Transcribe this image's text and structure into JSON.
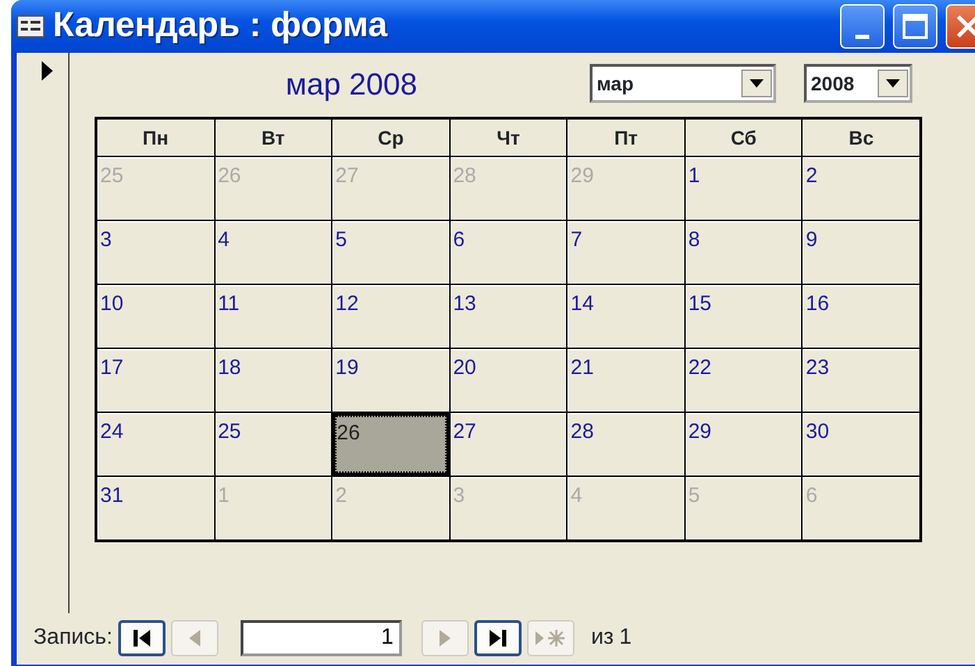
{
  "window": {
    "title": "Календарь : форма"
  },
  "header": {
    "caption": "мар 2008",
    "month_combo": {
      "value": "мар"
    },
    "year_combo": {
      "value": "2008"
    }
  },
  "weekdays": [
    "Пн",
    "Вт",
    "Ср",
    "Чт",
    "Пт",
    "Сб",
    "Вс"
  ],
  "weeks": [
    [
      {
        "text": "25",
        "in_month": false,
        "selected": false
      },
      {
        "text": "26",
        "in_month": false,
        "selected": false
      },
      {
        "text": "27",
        "in_month": false,
        "selected": false
      },
      {
        "text": "28",
        "in_month": false,
        "selected": false
      },
      {
        "text": "29",
        "in_month": false,
        "selected": false
      },
      {
        "text": "1",
        "in_month": true,
        "selected": false
      },
      {
        "text": "2",
        "in_month": true,
        "selected": false
      }
    ],
    [
      {
        "text": "3",
        "in_month": true,
        "selected": false
      },
      {
        "text": "4",
        "in_month": true,
        "selected": false
      },
      {
        "text": "5",
        "in_month": true,
        "selected": false
      },
      {
        "text": "6",
        "in_month": true,
        "selected": false
      },
      {
        "text": "7",
        "in_month": true,
        "selected": false
      },
      {
        "text": "8",
        "in_month": true,
        "selected": false
      },
      {
        "text": "9",
        "in_month": true,
        "selected": false
      }
    ],
    [
      {
        "text": "10",
        "in_month": true,
        "selected": false
      },
      {
        "text": "11",
        "in_month": true,
        "selected": false
      },
      {
        "text": "12",
        "in_month": true,
        "selected": false
      },
      {
        "text": "13",
        "in_month": true,
        "selected": false
      },
      {
        "text": "14",
        "in_month": true,
        "selected": false
      },
      {
        "text": "15",
        "in_month": true,
        "selected": false
      },
      {
        "text": "16",
        "in_month": true,
        "selected": false
      }
    ],
    [
      {
        "text": "17",
        "in_month": true,
        "selected": false
      },
      {
        "text": "18",
        "in_month": true,
        "selected": false
      },
      {
        "text": "19",
        "in_month": true,
        "selected": false
      },
      {
        "text": "20",
        "in_month": true,
        "selected": false
      },
      {
        "text": "21",
        "in_month": true,
        "selected": false
      },
      {
        "text": "22",
        "in_month": true,
        "selected": false
      },
      {
        "text": "23",
        "in_month": true,
        "selected": false
      }
    ],
    [
      {
        "text": "24",
        "in_month": true,
        "selected": false
      },
      {
        "text": "25",
        "in_month": true,
        "selected": false
      },
      {
        "text": "26",
        "in_month": true,
        "selected": true
      },
      {
        "text": "27",
        "in_month": true,
        "selected": false
      },
      {
        "text": "28",
        "in_month": true,
        "selected": false
      },
      {
        "text": "29",
        "in_month": true,
        "selected": false
      },
      {
        "text": "30",
        "in_month": true,
        "selected": false
      }
    ],
    [
      {
        "text": "31",
        "in_month": true,
        "selected": false
      },
      {
        "text": "1",
        "in_month": false,
        "selected": false
      },
      {
        "text": "2",
        "in_month": false,
        "selected": false
      },
      {
        "text": "3",
        "in_month": false,
        "selected": false
      },
      {
        "text": "4",
        "in_month": false,
        "selected": false
      },
      {
        "text": "5",
        "in_month": false,
        "selected": false
      },
      {
        "text": "6",
        "in_month": false,
        "selected": false
      }
    ]
  ],
  "navigation": {
    "label": "Запись:",
    "record": "1",
    "of_label": "из",
    "total": "1",
    "buttons": [
      {
        "kind": "first",
        "disabled": false
      },
      {
        "kind": "prev",
        "disabled": true
      },
      {
        "kind": "field"
      },
      {
        "kind": "next",
        "disabled": true
      },
      {
        "kind": "last",
        "disabled": false
      },
      {
        "kind": "new",
        "disabled": true
      }
    ]
  }
}
